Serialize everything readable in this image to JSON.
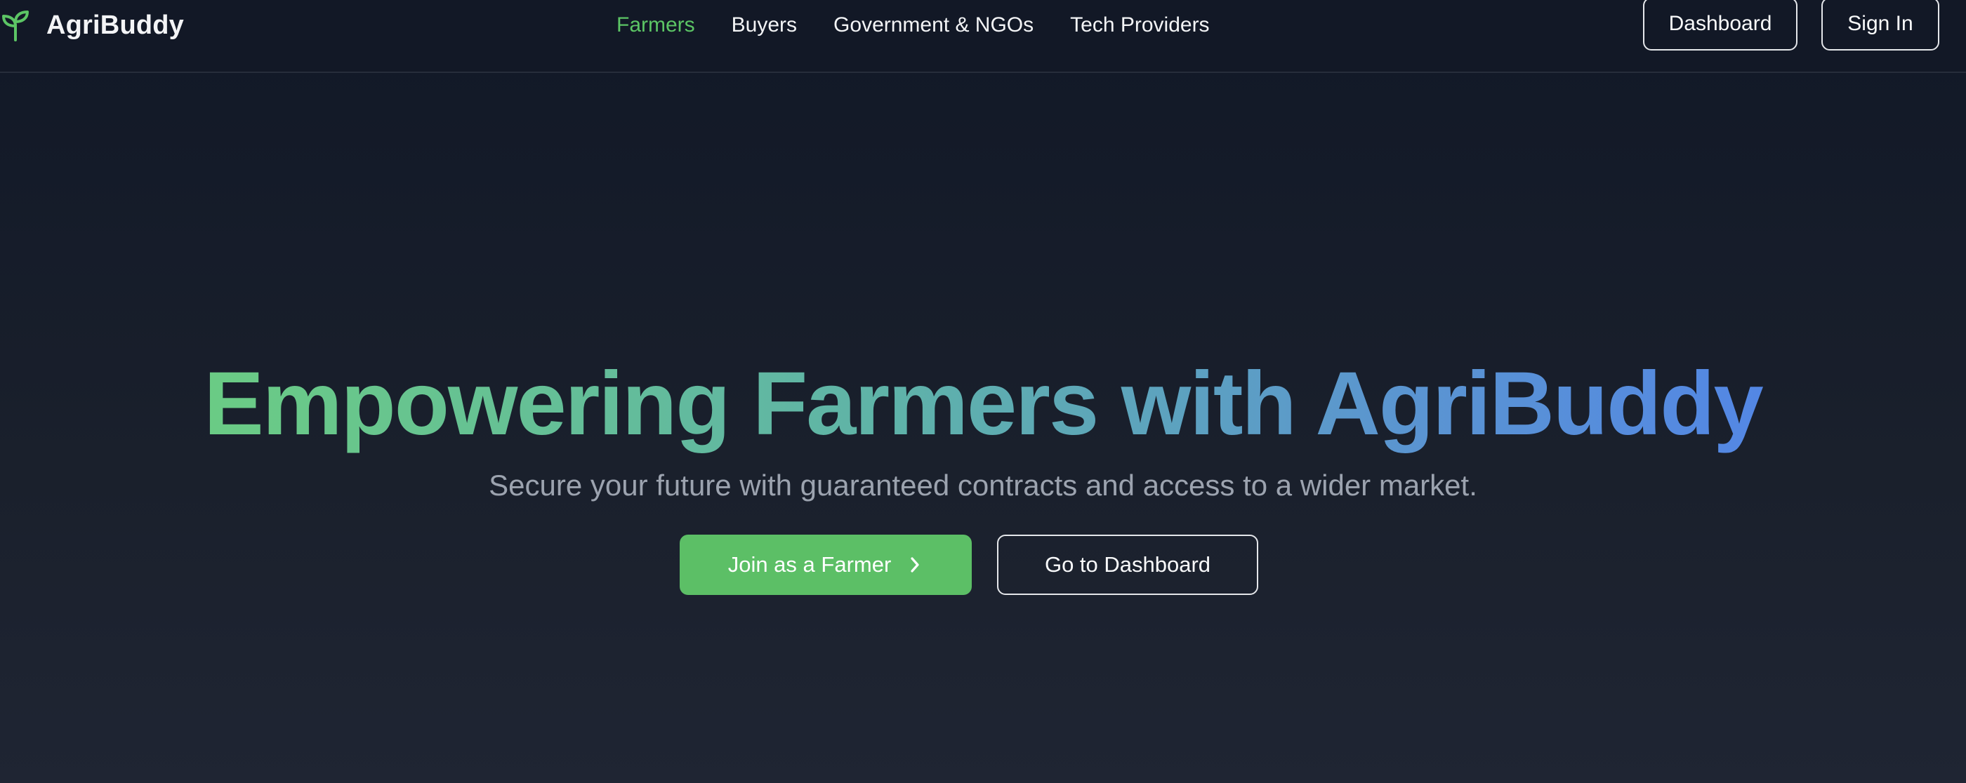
{
  "brand": {
    "name": "AgriBuddy",
    "icon": "sprout-icon",
    "accent_color": "#5cc565"
  },
  "nav": {
    "items": [
      {
        "label": "Farmers",
        "active": true
      },
      {
        "label": "Buyers",
        "active": false
      },
      {
        "label": "Government & NGOs",
        "active": false
      },
      {
        "label": "Tech Providers",
        "active": false
      }
    ]
  },
  "header_actions": {
    "dashboard_label": "Dashboard",
    "signin_label": "Sign In"
  },
  "hero": {
    "title": "Empowering Farmers with AgriBuddy",
    "subtitle": "Secure your future with guaranteed contracts and access to a wider market.",
    "primary_cta": "Join as a Farmer",
    "primary_cta_icon": "chevron-right-icon",
    "secondary_cta": "Go to Dashboard",
    "title_gradient": [
      "#6ed37a",
      "#4f7ff0"
    ],
    "primary_color": "#5cbf66"
  }
}
